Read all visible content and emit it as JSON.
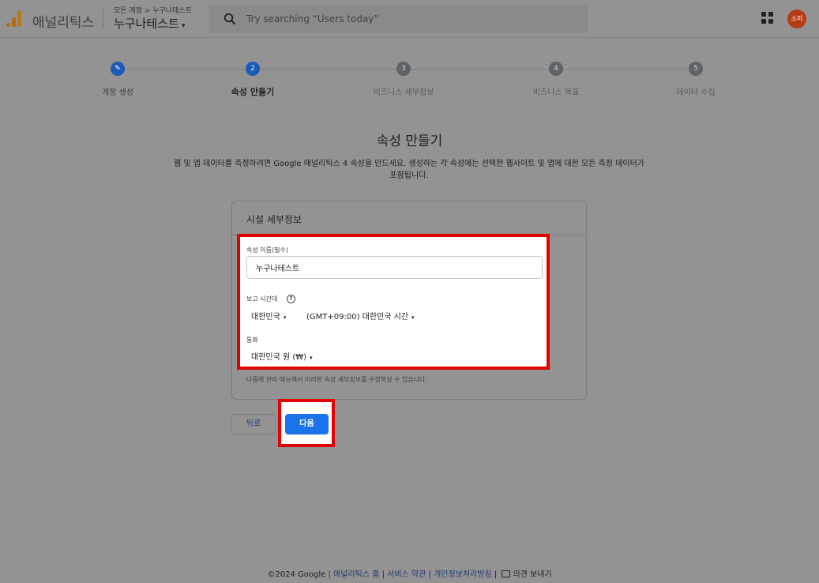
{
  "header": {
    "app_name": "애널리틱스",
    "breadcrumb": "모든 계정 > 누구나테스트",
    "property_name": "누구나테스트",
    "property_caret": "▾",
    "search_placeholder": "Try searching “Users today”",
    "avatar_text": "소미"
  },
  "stepper": {
    "steps": [
      {
        "number": "✎",
        "label": "계정 생성",
        "state": "done"
      },
      {
        "number": "2",
        "label": "속성 만들기",
        "state": "current"
      },
      {
        "number": "3",
        "label": "비즈니스 세부정보",
        "state": "upcoming"
      },
      {
        "number": "4",
        "label": "비즈니스 목표",
        "state": "upcoming"
      },
      {
        "number": "5",
        "label": "데이터 수집",
        "state": "upcoming"
      }
    ]
  },
  "main": {
    "title": "속성 만들기",
    "description": "웹 및 앱 데이터를 측정하려면 Google 애널리틱스 4 속성을 만드세요. 생성하는 각 속성에는 선택한 웹사이트 및 앱에 대한 모든 측정 데이터가 포함됩니다."
  },
  "card": {
    "title": "시설 세부정보",
    "property_name_label": "속성 이름(필수)",
    "property_name_value": "누구나테스트",
    "timezone_label": "보고 시간대",
    "help_icon_text": "?",
    "timezone_country": "대한민국",
    "timezone_value": "(GMT+09:00) 대한민국 시간",
    "currency_label": "통화",
    "currency_value": "대한민국 원 (₩)",
    "dropdown_caret": "▾",
    "note": "나중에 관리 메뉴에서 이러한 속성 세부정보를 수정하실 수 있습니다."
  },
  "actions": {
    "back_label": "뒤로",
    "next_label": "다음"
  },
  "footer": {
    "copyright": "©2024 Google",
    "separator": "|",
    "home_link": "애널리틱스 홈",
    "terms_link": "서비스 약관",
    "privacy_link": "개인정보처리방침",
    "feedback": "의견 보내기"
  },
  "colors": {
    "highlight": "#e00000",
    "primary": "#1a73e8",
    "overlay_bg": "#939393"
  }
}
